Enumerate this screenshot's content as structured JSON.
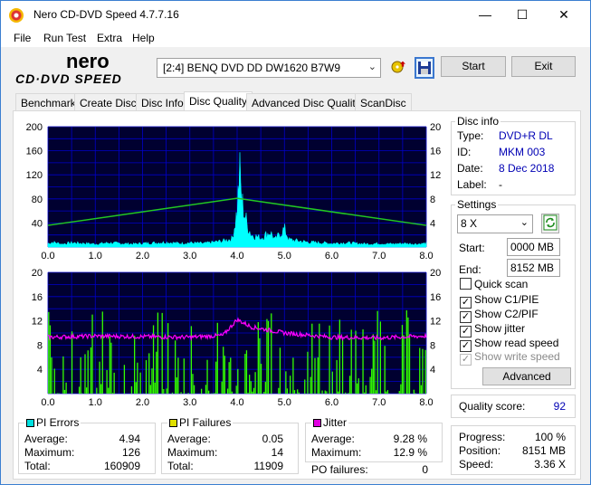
{
  "window": {
    "title": "Nero CD-DVD Speed 4.7.7.16",
    "minimize": "—",
    "maximize": "☐",
    "close": "✕"
  },
  "menu": [
    "File",
    "Run Test",
    "Extra",
    "Help"
  ],
  "logo": {
    "line1": "nero",
    "line2": "CD·DVD SPEED"
  },
  "toolbar": {
    "drive": "[2:4]   BENQ DVD DD DW1620 B7W9",
    "start_label": "Start",
    "exit_label": "Exit"
  },
  "tabs": [
    "Benchmark",
    "Create Disc",
    "Disc Info",
    "Disc Quality",
    "Advanced Disc Quality",
    "ScanDisc"
  ],
  "disc_info": {
    "title": "Disc info",
    "rows": [
      {
        "label": "Type:",
        "value": "DVD+R DL"
      },
      {
        "label": "ID:",
        "value": "MKM 003"
      },
      {
        "label": "Date:",
        "value": "8 Dec 2018"
      },
      {
        "label": "Label:",
        "value": "-"
      }
    ]
  },
  "settings": {
    "title": "Settings",
    "speed": "8 X",
    "start_label": "Start:",
    "start_value": "0000 MB",
    "end_label": "End:",
    "end_value": "8152 MB",
    "checks": [
      {
        "label": "Quick scan",
        "checked": false,
        "disabled": false
      },
      {
        "label": "Show C1/PIE",
        "checked": true,
        "disabled": false
      },
      {
        "label": "Show C2/PIF",
        "checked": true,
        "disabled": false
      },
      {
        "label": "Show jitter",
        "checked": true,
        "disabled": false
      },
      {
        "label": "Show read speed",
        "checked": true,
        "disabled": false
      },
      {
        "label": "Show write speed",
        "checked": true,
        "disabled": true
      }
    ],
    "advanced_label": "Advanced"
  },
  "quality": {
    "label": "Quality score:",
    "value": "92"
  },
  "progress": {
    "rows": [
      {
        "label": "Progress:",
        "value": "100 %"
      },
      {
        "label": "Position:",
        "value": "8151 MB"
      },
      {
        "label": "Speed:",
        "value": "3.36 X"
      }
    ]
  },
  "stats": {
    "pi_errors": {
      "title": "PI Errors",
      "color": "#00e0e0",
      "average_label": "Average:",
      "average": "4.94",
      "maximum_label": "Maximum:",
      "maximum": "126",
      "total_label": "Total:",
      "total": "160909"
    },
    "pi_failures": {
      "title": "PI Failures",
      "color": "#e0e000",
      "average_label": "Average:",
      "average": "0.05",
      "maximum_label": "Maximum:",
      "maximum": "14",
      "total_label": "Total:",
      "total": "11909"
    },
    "jitter": {
      "title": "Jitter",
      "color": "#e000e0",
      "average_label": "Average:",
      "average": "9.28 %",
      "maximum_label": "Maximum:",
      "maximum": "12.9 %",
      "po_label": "PO failures:",
      "po": "0"
    }
  },
  "chart_data": [
    {
      "type": "area",
      "name": "PI errors / read speed",
      "x_ticks": [
        "0.0",
        "1.0",
        "2.0",
        "3.0",
        "4.0",
        "5.0",
        "6.0",
        "7.0",
        "8.0"
      ],
      "y_left_ticks": [
        "200",
        "160",
        "120",
        "80",
        "40"
      ],
      "y_right_ticks": [
        "20",
        "16",
        "12",
        "8",
        "4"
      ],
      "xlim": [
        0,
        8.0
      ],
      "ylim_left": [
        0,
        200
      ],
      "ylim_right": [
        0,
        20
      ],
      "colors": {
        "background": "#000030",
        "grid": "#0000c8",
        "pie": "#00ffff",
        "speed": "#22c822"
      },
      "pie_profile": [
        [
          0.0,
          6
        ],
        [
          0.1,
          8
        ],
        [
          0.3,
          5
        ],
        [
          0.5,
          7
        ],
        [
          0.8,
          6
        ],
        [
          1.0,
          5
        ],
        [
          1.3,
          7
        ],
        [
          1.5,
          6
        ],
        [
          1.8,
          5
        ],
        [
          2.0,
          6
        ],
        [
          2.3,
          7
        ],
        [
          2.5,
          8
        ],
        [
          2.8,
          6
        ],
        [
          3.0,
          7
        ],
        [
          3.3,
          6
        ],
        [
          3.5,
          8
        ],
        [
          3.7,
          10
        ],
        [
          3.9,
          14
        ],
        [
          4.0,
          60
        ],
        [
          4.05,
          126
        ],
        [
          4.1,
          75
        ],
        [
          4.2,
          40
        ],
        [
          4.3,
          20
        ],
        [
          4.5,
          15
        ],
        [
          4.7,
          25
        ],
        [
          4.8,
          12
        ],
        [
          5.0,
          30
        ],
        [
          5.1,
          12
        ],
        [
          5.3,
          10
        ],
        [
          5.5,
          8
        ],
        [
          5.8,
          7
        ],
        [
          6.0,
          6
        ],
        [
          6.3,
          7
        ],
        [
          6.5,
          6
        ],
        [
          6.8,
          5
        ],
        [
          7.0,
          6
        ],
        [
          7.3,
          5
        ],
        [
          7.5,
          6
        ],
        [
          7.8,
          5
        ],
        [
          8.0,
          6
        ]
      ],
      "speed_profile": [
        [
          0.0,
          3.6
        ],
        [
          4.0,
          8.1
        ],
        [
          8.0,
          3.6
        ]
      ]
    },
    {
      "type": "bar",
      "name": "PI failures / jitter",
      "x_ticks": [
        "0.0",
        "1.0",
        "2.0",
        "3.0",
        "4.0",
        "5.0",
        "6.0",
        "7.0",
        "8.0"
      ],
      "y_left_ticks": [
        "20",
        "16",
        "12",
        "8",
        "4"
      ],
      "y_right_ticks": [
        "20",
        "16",
        "12",
        "8",
        "4"
      ],
      "xlim": [
        0,
        8.0
      ],
      "ylim_left": [
        0,
        20
      ],
      "ylim_right": [
        0,
        20
      ],
      "colors": {
        "background": "#000030",
        "grid": "#0000c8",
        "pif": "#33ff00",
        "jitter": "#ff00ff"
      },
      "jitter_profile": [
        [
          0.0,
          9.3
        ],
        [
          1.0,
          9.5
        ],
        [
          2.0,
          9.4
        ],
        [
          3.0,
          9.3
        ],
        [
          3.7,
          9.6
        ],
        [
          4.0,
          12.2
        ],
        [
          4.3,
          11.0
        ],
        [
          5.0,
          10.0
        ],
        [
          6.0,
          9.3
        ],
        [
          7.0,
          9.2
        ],
        [
          8.0,
          9.5
        ]
      ],
      "pif_max": 14
    }
  ]
}
